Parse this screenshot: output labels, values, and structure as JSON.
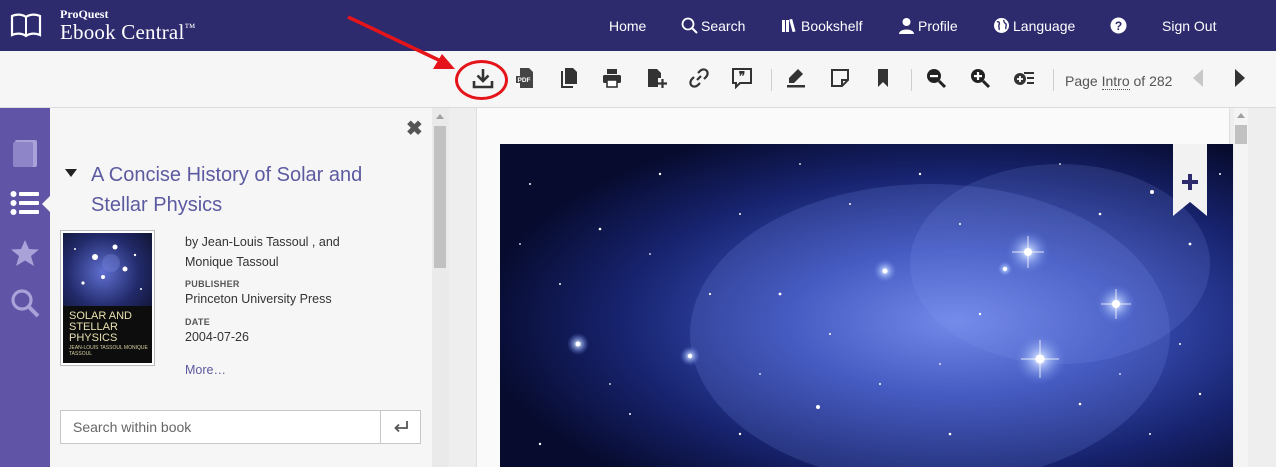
{
  "header": {
    "logo_small": "ProQuest",
    "logo_big": "Ebook Central",
    "logo_tm": "™",
    "nav": {
      "home": "Home",
      "search": "Search",
      "bookshelf": "Bookshelf",
      "profile": "Profile",
      "language": "Language",
      "sign_out": "Sign Out"
    },
    "icons": [
      "open-book-icon",
      "search-icon",
      "bookshelf-icon",
      "person-icon",
      "globe-icon",
      "help-icon"
    ]
  },
  "toolbar": {
    "icons": [
      "download-icon",
      "pdf-icon",
      "copy-icon",
      "print-icon",
      "add-page-icon",
      "link-icon",
      "cite-icon",
      "highlighter-icon",
      "note-icon",
      "bookmark-icon",
      "zoom-out-icon",
      "zoom-in-icon",
      "add-to-list-icon",
      "previous-page-icon",
      "next-page-icon"
    ],
    "pdf_label": "PDF",
    "page_prefix": "Page",
    "page_current": "Intro",
    "page_suffix": "of 282"
  },
  "rail": {
    "icons": [
      "book-icon",
      "table-of-contents-icon",
      "star-icon",
      "search-icon"
    ]
  },
  "panel": {
    "close_glyph": "✖",
    "title": "A Concise History of Solar and Stellar Physics",
    "cover": {
      "title": "SOLAR AND STELLAR PHYSICS",
      "authors": "JEAN-LOUIS TASSOUL MONIQUE TASSOUL"
    },
    "byline": "by Jean-Louis Tassoul , and Monique Tassoul",
    "publisher_label": "PUBLISHER",
    "publisher": "Princeton University Press",
    "date_label": "DATE",
    "date": "2004-07-26",
    "more": "More…",
    "search_placeholder": "Search within book"
  },
  "colors": {
    "header_bg": "#2d2a6e",
    "rail_bg": "#6054a6",
    "title_color": "#5c5aa0",
    "annotation_red": "#e5141a"
  }
}
